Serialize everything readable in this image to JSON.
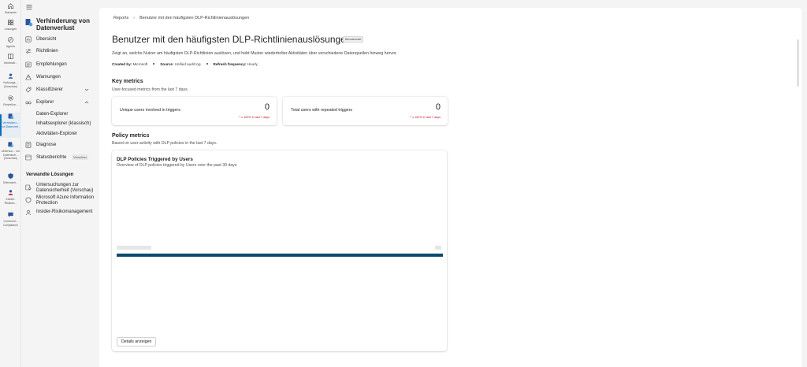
{
  "rail": {
    "items": [
      {
        "label": "Startseite",
        "icon": "home-icon"
      },
      {
        "label": "Lösungen",
        "icon": "grid-icon"
      },
      {
        "label": "Agents",
        "icon": "agents-icon"
      },
      {
        "label": "Informati...",
        "icon": "book-icon"
      },
      {
        "label": "Nutzungs... (Vorschau)",
        "icon": "people-icon"
      },
      {
        "label": "Einstellun...",
        "icon": "gear-icon"
      },
      {
        "label": "Verhinderu... von Datenverl...",
        "icon": "dlp-icon"
      },
      {
        "label": "Untersuc... zur Datensich... (Vorschau)",
        "icon": "investigation-icon"
      },
      {
        "label": "Überwach...",
        "icon": "shield-icon"
      },
      {
        "label": "Insider-Risikom...",
        "icon": "insider-icon"
      },
      {
        "label": "Communi... Compliance",
        "icon": "chat-icon"
      }
    ]
  },
  "nav": {
    "title": "Verhinderung von Datenverlust",
    "items": [
      {
        "label": "Übersicht",
        "icon": "overview-icon"
      },
      {
        "label": "Richtlinien",
        "icon": "policies-icon"
      },
      {
        "label": "Empfehlungen",
        "icon": "recommendations-icon"
      },
      {
        "label": "Warnungen",
        "icon": "alerts-icon"
      },
      {
        "label": "Klassifizierer",
        "icon": "classifier-icon"
      },
      {
        "label": "Explorer",
        "icon": "explorer-icon"
      }
    ],
    "explorer_sub": [
      "Daten-Explorer",
      "Inhaltsexplorer (klassisch)",
      "Aktivitäten-Explorer"
    ],
    "items_b": [
      {
        "label": "Diagnose",
        "icon": "diagnose-icon"
      },
      {
        "label": "Statusberichte",
        "icon": "reports-icon",
        "badge": "Vorschau"
      }
    ],
    "related_title": "Verwandte Lösungen",
    "related": [
      {
        "label": "Untersuchungen zur Datensicherheit (Vorschau)",
        "icon": "investigation-icon"
      },
      {
        "label": "Microsoft Azure Information Protection",
        "icon": "azure-icon"
      },
      {
        "label": "Insider-Risikomanagement",
        "icon": "insider-icon"
      }
    ]
  },
  "breadcrumb": {
    "root": "Reports",
    "current": "Benutzer mit den häufigsten DLP-Richtlinienauslösungen"
  },
  "page": {
    "title": "Benutzer mit den häufigsten DLP-Richtlinienauslösungen",
    "badge": "Benutzerdef",
    "description": "Zeigt an, welche Nutzer am häufigsten DLP-Richtlinien auslösen, und hebt Muster wiederholter Aktivitäten über verschiedene Datenquellen hinweg hervor.",
    "created_by_label": "Created by:",
    "created_by": "Microsoft",
    "source_label": "Source:",
    "source": "Unified audit log",
    "refresh_label": "Refresh frequency:",
    "refresh": "Hourly"
  },
  "key_metrics": {
    "title": "Key metrics",
    "subtitle": "User-focused metrics from the last 7 days.",
    "cards": [
      {
        "label": "Unique users involved in triggers",
        "value": "0",
        "trend": "⁺↘ 100% in last 7 days"
      },
      {
        "label": "Total users with repeated triggers",
        "value": "0",
        "trend": "⁺↘ 100% in last 7 days"
      }
    ]
  },
  "policy_metrics": {
    "title": "Policy metrics",
    "subtitle": "Based on user activity with DLP policies in the last 7 days."
  },
  "chart_data": {
    "type": "bar",
    "title": "DLP Policies Triggered by Users",
    "subtitle": "Overview of DLP policies triggered by Users over the past 30 days",
    "categories": [
      ""
    ],
    "series": [
      {
        "values": [
          100
        ]
      }
    ],
    "color": "#0b4a6f"
  },
  "chart_button": "Details anzeigen"
}
